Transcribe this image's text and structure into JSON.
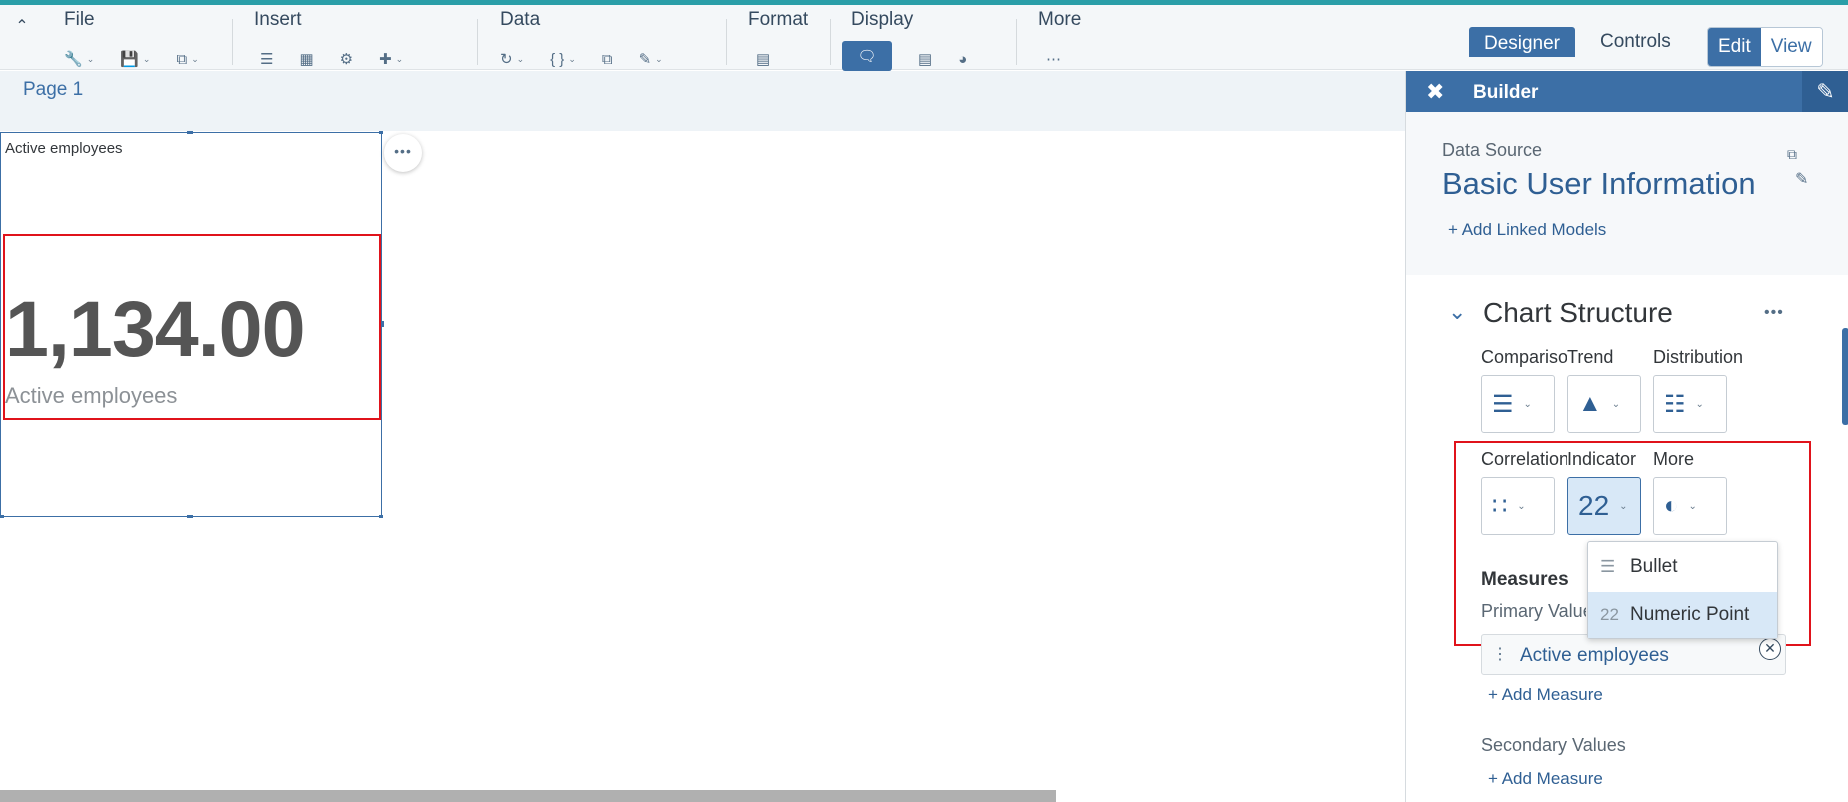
{
  "toolbar": {
    "groups": {
      "file": "File",
      "insert": "Insert",
      "data": "Data",
      "format": "Format",
      "display": "Display",
      "more": "More"
    },
    "modes": {
      "designer": "Designer",
      "controls": "Controls"
    },
    "view_toggle": {
      "edit": "Edit",
      "view": "View"
    }
  },
  "page_tab": "Page 1",
  "widget": {
    "title": "Active employees",
    "value": "1,134.00",
    "label": "Active employees",
    "more_glyph": "•••"
  },
  "builder": {
    "title": "Builder",
    "data_source_label": "Data Source",
    "data_source_name": "Basic User Information",
    "add_linked_models": "+ Add Linked Models",
    "chart_structure": "Chart Structure",
    "categories": {
      "comparison": "Comparison",
      "trend": "Trend",
      "distribution": "Distribution",
      "correlation": "Correlation",
      "indicator": "Indicator",
      "more": "More"
    },
    "measures_title": "Measures",
    "primary_values_label": "Primary Values",
    "primary_measure": "Active employees",
    "add_measure": "+ Add Measure",
    "secondary_values_label": "Secondary Values",
    "add_measure_secondary": "+ Add Measure"
  },
  "dropdown": {
    "items": [
      {
        "label": "Bullet",
        "icon": "bullet-chart-icon",
        "selected": false
      },
      {
        "label": "Numeric Point",
        "icon": "numeric-point-icon",
        "selected": true
      }
    ]
  },
  "colors": {
    "accent": "#3c6fa6",
    "highlight_box": "#e0131b",
    "top_line": "#2a9ea8"
  }
}
